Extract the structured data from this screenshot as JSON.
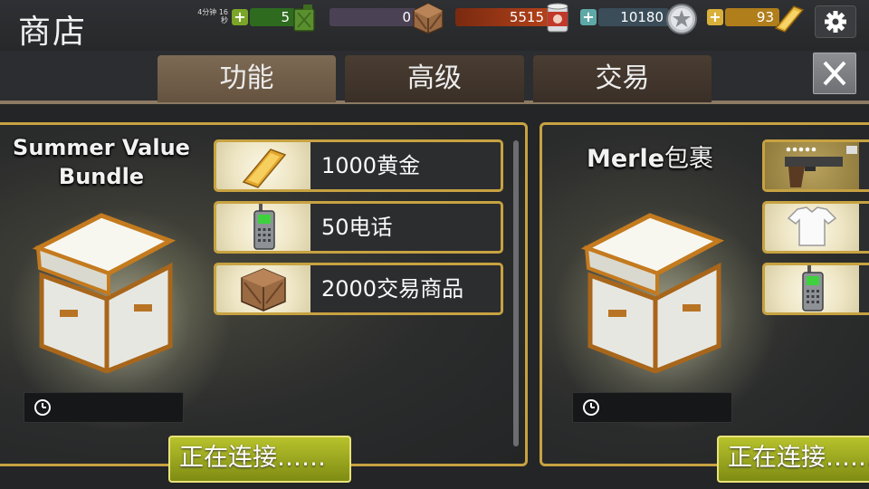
{
  "header": {
    "title": "商店",
    "timer_line1": "4分钟 16",
    "timer_line2": "秒",
    "resources": [
      {
        "name": "fuel",
        "value": "5",
        "icon": "fuel-can-icon",
        "color": "#2e6b1f"
      },
      {
        "name": "trade-goods",
        "value": "0",
        "icon": "crate-icon",
        "color": "#4a4254"
      },
      {
        "name": "food",
        "value": "5515",
        "icon": "food-can-icon",
        "color": "#a13714"
      },
      {
        "name": "tokens",
        "value": "10180",
        "icon": "sheriff-badge-icon",
        "color": "#3b4d59"
      },
      {
        "name": "gold",
        "value": "93",
        "icon": "gold-bar-icon",
        "color": "#b07e1b"
      }
    ]
  },
  "tabs": [
    "功能",
    "高级",
    "交易"
  ],
  "bundles": [
    {
      "title_line1": "Summer Value",
      "title_line2": "Bundle",
      "items": [
        {
          "label": "1000黄金",
          "icon": "gold-bar-icon"
        },
        {
          "label": "50电话",
          "icon": "walkie-talkie-icon"
        },
        {
          "label": "2000交易商品",
          "icon": "crate-icon"
        }
      ],
      "button": "正在连接……"
    },
    {
      "title_prefix": "Merle",
      "title_suffix": "包裹",
      "items": [
        {
          "label": "",
          "icon": "pistol-icon"
        },
        {
          "label": "",
          "icon": "tshirt-icon"
        },
        {
          "label": "",
          "icon": "walkie-talkie-icon"
        }
      ],
      "button": "正在连接……"
    }
  ],
  "colors": {
    "accent_gold": "#c7a241",
    "buy_green": "#9aa81f",
    "tab_active": "#7d6a55"
  }
}
